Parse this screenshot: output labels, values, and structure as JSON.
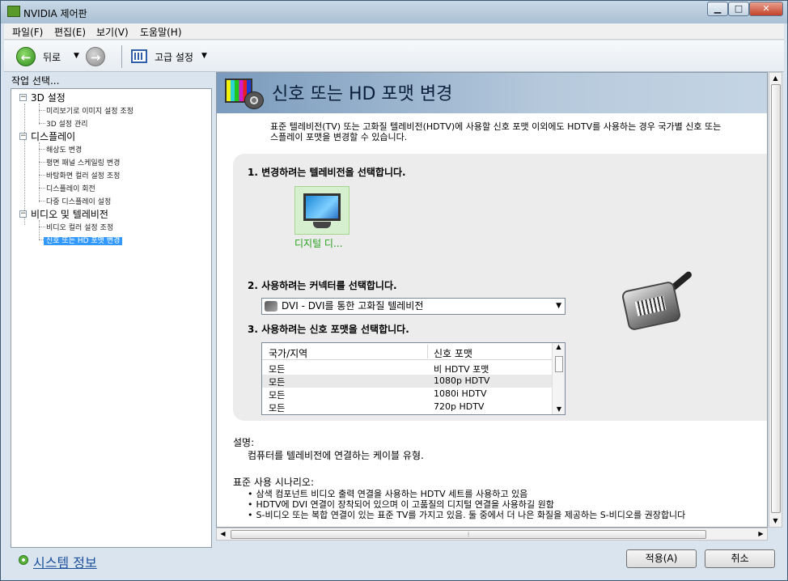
{
  "window": {
    "title": "NVIDIA 제어판"
  },
  "menu": {
    "items": [
      "파일(F)",
      "편집(E)",
      "보기(V)",
      "도움말(H)"
    ]
  },
  "toolbar": {
    "back_label": "뒤로",
    "advanced_label": "고급 설정"
  },
  "sidebar": {
    "heading": "작업 선택...",
    "groups": [
      {
        "label": "3D 설정",
        "items": [
          "미리보기로 이미지 설정 조정",
          "3D 설정 관리"
        ]
      },
      {
        "label": "디스플레이",
        "items": [
          "해상도 변경",
          "평면 패널 스케일링 변경",
          "바탕화면 컬러 설정 조정",
          "디스플레이 회전",
          "다중 디스플레이 설정"
        ]
      },
      {
        "label": "비디오 및 텔레비전",
        "items": [
          "비디오 컬러 설정 조정",
          "신호 또는 HD 포맷 변경"
        ]
      }
    ],
    "selected": "신호 또는 HD 포맷 변경"
  },
  "page": {
    "title": "신호 또는 HD 포맷 변경",
    "intro_line1": "표준 텔레비전(TV) 또는 고화질 텔레비전(HDTV)에 사용할 신호 포맷 이외에도 HDTV를 사용하는 경우 국가별 신호 또는",
    "intro_line2": "스플레이 포맷을 변경할 수 있습니다.",
    "step1": "1. 변경하려는 텔레비전을 선택합니다.",
    "tv_label": "디지털 디...",
    "step2": "2. 사용하려는 커넥터를 선택합니다.",
    "connector_value": "DVI - DVI를 통한 고화질 텔레비전",
    "step3": "3. 사용하려는 신호 포맷을 선택합니다.",
    "table": {
      "col_region": "국가/지역",
      "col_format": "신호 포맷",
      "rows": [
        {
          "region": "모든",
          "format": "비 HDTV 포맷"
        },
        {
          "region": "모든",
          "format": "1080p HDTV"
        },
        {
          "region": "모든",
          "format": "1080i HDTV"
        },
        {
          "region": "모든",
          "format": "720p HDTV"
        }
      ]
    },
    "description_label": "설명:",
    "description_text": "컴퓨터를 텔레비전에 연결하는 케이블 유형.",
    "scenarios_label": "표준 사용 시나리오:",
    "scenarios": [
      "삼색 컴포넌트 비디오 출력 연결을 사용하는 HDTV 세트를 사용하고 있음",
      "HDTV에 DVI 연결이 장착되어 있으며 이 고품질의 디지털 연결을 사용하길 원함",
      "S-비디오 또는 복합 연결이 있는 표준 TV를 가지고 있음. 둘 중에서 더 나은 화질을 제공하는 S-비디오를 권장합니다"
    ]
  },
  "footer": {
    "system_info": "시스템 정보",
    "apply": "적용(A)",
    "cancel": "취소"
  }
}
